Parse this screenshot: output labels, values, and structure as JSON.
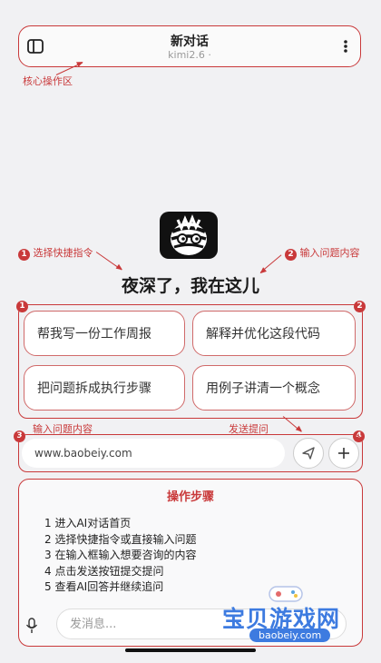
{
  "header": {
    "title": "新对话",
    "model": "kimi2.6 ·"
  },
  "annotations": {
    "core_area": "核心操作区",
    "choose_shortcut": "选择快捷指令",
    "choose_shortcut_num": "1",
    "input_question": "输入问题内容",
    "input_question_num": "2",
    "box_num_left": "1",
    "box_num_right": "2",
    "input_label": "输入问题内容",
    "send_label": "发送提问",
    "num_3": "3",
    "num_4": "4"
  },
  "greeting": "夜深了，我在这儿",
  "shortcuts": [
    {
      "label": "帮我写一份工作周报"
    },
    {
      "label": "解释并优化这段代码"
    },
    {
      "label": "把问题拆成执行步骤"
    },
    {
      "label": "用例子讲清一个概念"
    }
  ],
  "input": {
    "value": "www.baobeiy.com",
    "placeholder": "发消息..."
  },
  "steps": {
    "title": "操作步骤",
    "items": [
      "1 进入AI对话首页",
      "2 选择快捷指令或直接输入问题",
      "3 在输入框输入想要咨询的内容",
      "4 点击发送按钮提交提问",
      "5 查看AI回答并继续追问"
    ]
  },
  "watermark": {
    "name": "宝贝游戏网",
    "url": "baobeiy.com"
  },
  "colors": {
    "accent": "#c9393a",
    "card_border": "#d06a6a"
  },
  "icons": [
    "sidebar-icon",
    "more-icon",
    "zebra-logo",
    "send-icon",
    "plus-icon",
    "mic-icon",
    "gamepad-icon"
  ]
}
